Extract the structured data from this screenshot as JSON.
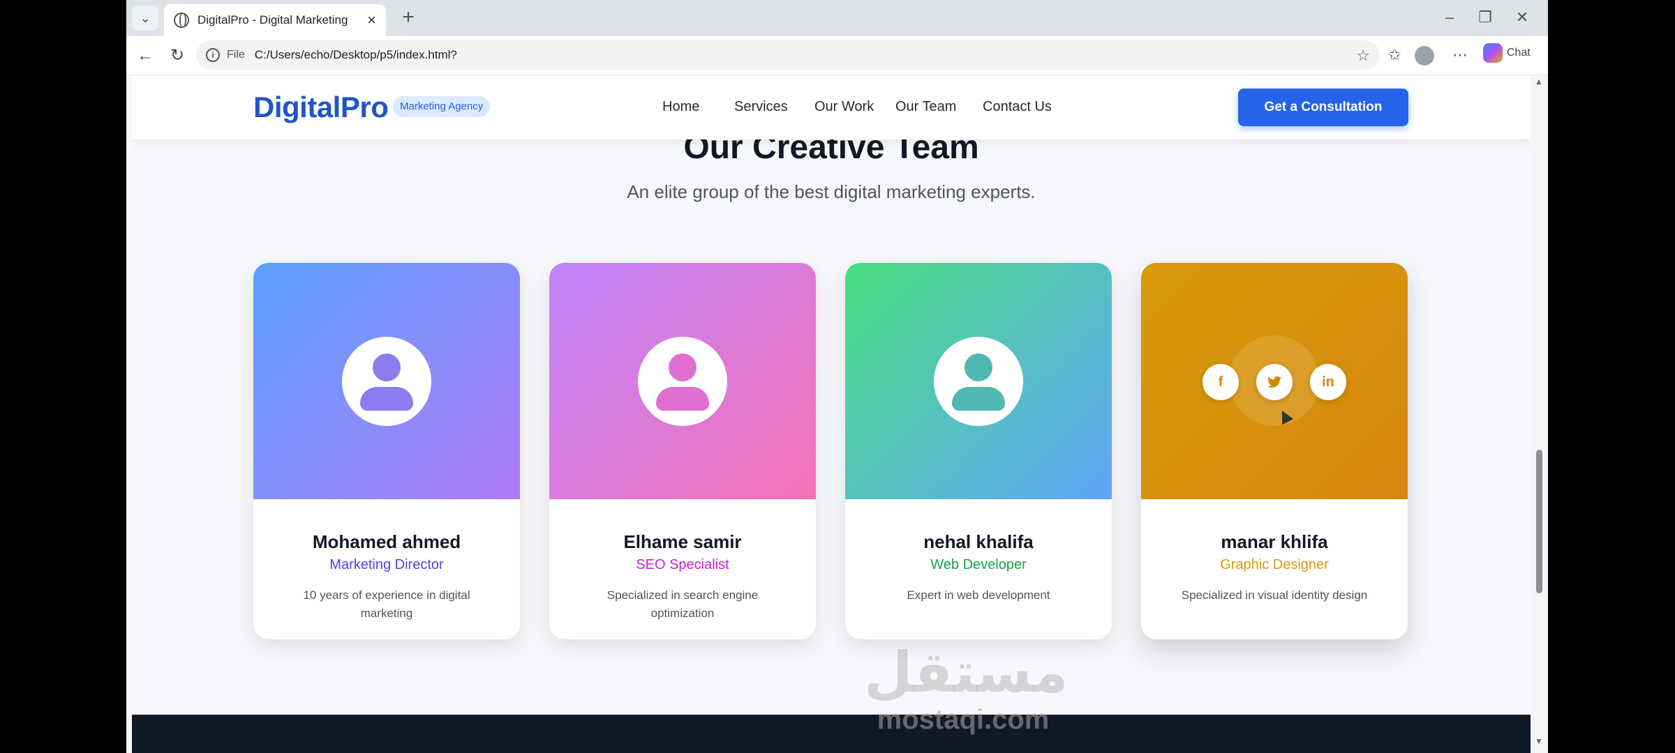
{
  "browser": {
    "tab_title": "DigitalPro - Digital Marketing",
    "url_scheme": "File",
    "url": "C:/Users/echo/Desktop/p5/index.html?",
    "chat_label": "Chat"
  },
  "header": {
    "logo": "DigitalPro",
    "badge": "Marketing Agency",
    "nav": [
      "Home",
      "Services",
      "Our Work",
      "Our Team",
      "Contact Us"
    ],
    "cta": "Get a Consultation"
  },
  "section": {
    "title": "Our Creative Team",
    "subtitle": "An elite group of the best digital marketing experts."
  },
  "team": [
    {
      "name": "Mohamed ahmed",
      "role": "Marketing Director",
      "desc": "10 years of experience in digital marketing",
      "gradient": [
        "#5aa0ff",
        "#b07cf7"
      ],
      "role_color": "#4f46e5",
      "avatar_color": "#8b7cf0"
    },
    {
      "name": "Elhame samir",
      "role": "SEO Specialist",
      "desc": "Specialized in search engine optimization",
      "gradient": [
        "#c084fc",
        "#f472b6"
      ],
      "role_color": "#c026d3",
      "avatar_color": "#e06fd0"
    },
    {
      "name": "nehal khalifa",
      "role": "Web Developer",
      "desc": "Expert in web development",
      "gradient": [
        "#4ade80",
        "#60a5fa"
      ],
      "role_color": "#16a34a",
      "avatar_color": "#4fb8b0"
    },
    {
      "name": "manar khlifa",
      "role": "Graphic Designer",
      "desc": "Specialized in visual identity design",
      "gradient": [
        "#d99a0b",
        "#d4870c"
      ],
      "role_color": "#d99a0b",
      "avatar_color": "#d08a08"
    }
  ],
  "social": [
    "f",
    "t",
    "in"
  ],
  "watermark": {
    "arabic": "مستقل",
    "latin": "mostaqi.com"
  }
}
